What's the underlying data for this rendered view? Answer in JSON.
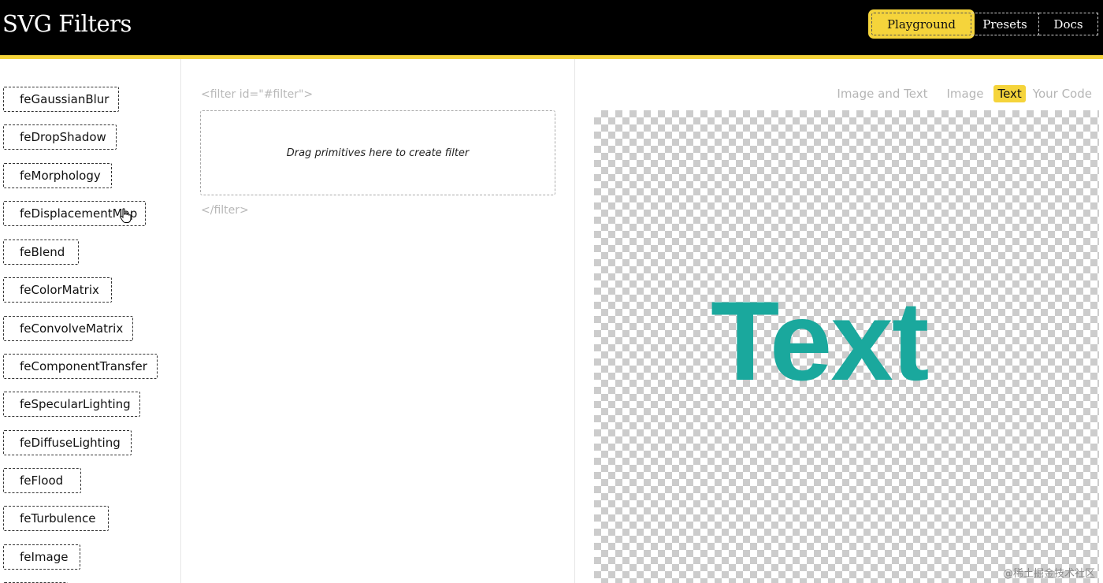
{
  "header": {
    "title": "SVG Filters",
    "nav": [
      {
        "label": "Playground",
        "active": true
      },
      {
        "label": "Presets",
        "active": false
      },
      {
        "label": "Docs",
        "active": false
      }
    ]
  },
  "sidebar": {
    "primitives": [
      "feGaussianBlur",
      "feDropShadow",
      "feMorphology",
      "feDisplacementMap",
      "feBlend",
      "feColorMatrix",
      "feConvolveMatrix",
      "feComponentTransfer",
      "feSpecularLighting",
      "feDiffuseLighting",
      "feFlood",
      "feTurbulence",
      "feImage"
    ]
  },
  "editor": {
    "open_tag": "<filter id=\"#filter\">",
    "close_tag": "</filter>",
    "dropzone_hint": "Drag primitives here to create filter"
  },
  "preview": {
    "tabs": [
      {
        "label": "Image and Text",
        "active": false
      },
      {
        "label": "Image",
        "active": false
      },
      {
        "label": "Text",
        "active": true
      },
      {
        "label": "Your Code",
        "active": false
      }
    ],
    "sample_text": "Text",
    "text_color": "#1aa89d"
  },
  "watermark": "@稀土掘金技术社区",
  "colors": {
    "accent": "#f5d43b",
    "header_bg": "#000000"
  }
}
